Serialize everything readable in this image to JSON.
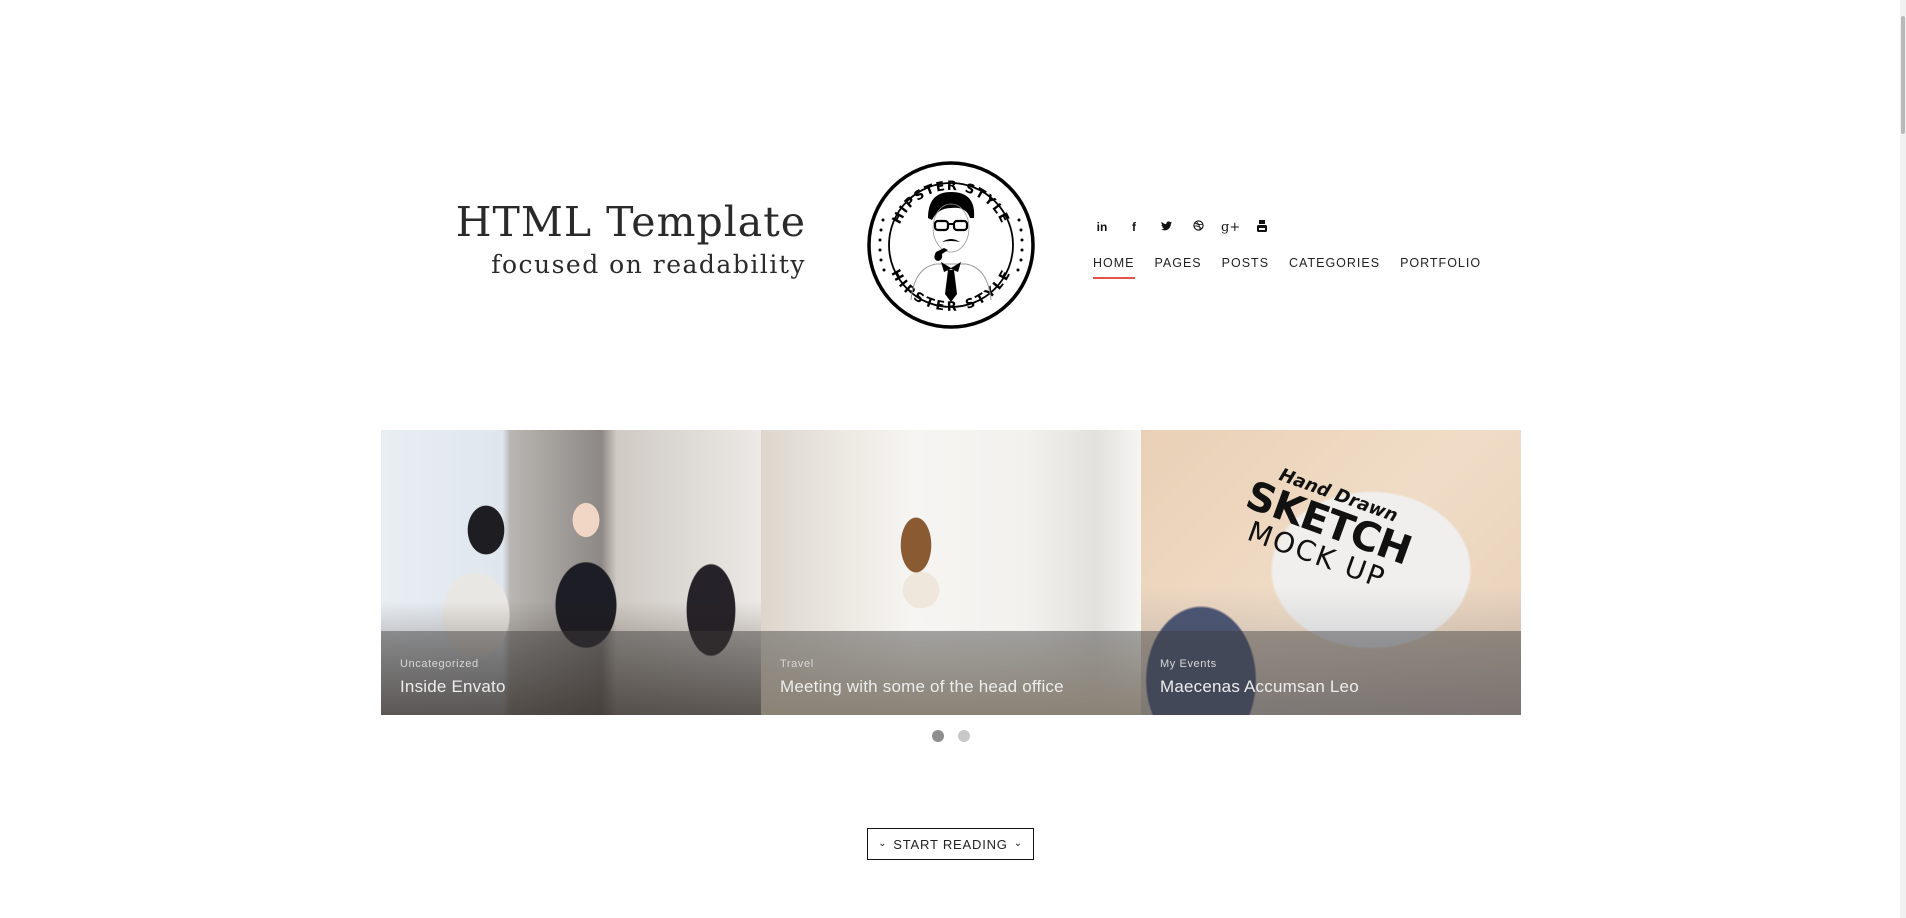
{
  "brand": {
    "title": "HTML Template",
    "subtitle": "focused on readability"
  },
  "logo": {
    "text_top": "HIPSTER STYLE",
    "text_bottom": "HIPSTER STYLE"
  },
  "social": [
    {
      "name": "linkedin-icon",
      "glyph": "in"
    },
    {
      "name": "facebook-icon",
      "glyph": "f"
    },
    {
      "name": "twitter-icon",
      "glyph": "🐦"
    },
    {
      "name": "dribbble-icon",
      "glyph": "⊛"
    },
    {
      "name": "google-plus-icon",
      "glyph": "g+"
    },
    {
      "name": "youtube-icon",
      "glyph": "▣"
    }
  ],
  "nav": {
    "items": [
      {
        "label": "HOME",
        "active": true
      },
      {
        "label": "PAGES",
        "active": false
      },
      {
        "label": "POSTS",
        "active": false
      },
      {
        "label": "CATEGORIES",
        "active": false
      },
      {
        "label": "PORTFOLIO",
        "active": false
      }
    ],
    "accent_color": "#e5534b"
  },
  "slider": {
    "slides": [
      {
        "category": "Uncategorized",
        "title": "Inside Envato"
      },
      {
        "category": "Travel",
        "title": "Meeting with some of the head office"
      },
      {
        "category": "My Events",
        "title": "Maecenas Accumsan Leo",
        "image_text": [
          "Hand Drawn",
          "SKETCH",
          "MOCK UP"
        ]
      }
    ],
    "pagination": {
      "count": 2,
      "active": 1
    }
  },
  "cta": {
    "label": "START READING",
    "icon_left": "⌄",
    "icon_right": "⌄"
  }
}
